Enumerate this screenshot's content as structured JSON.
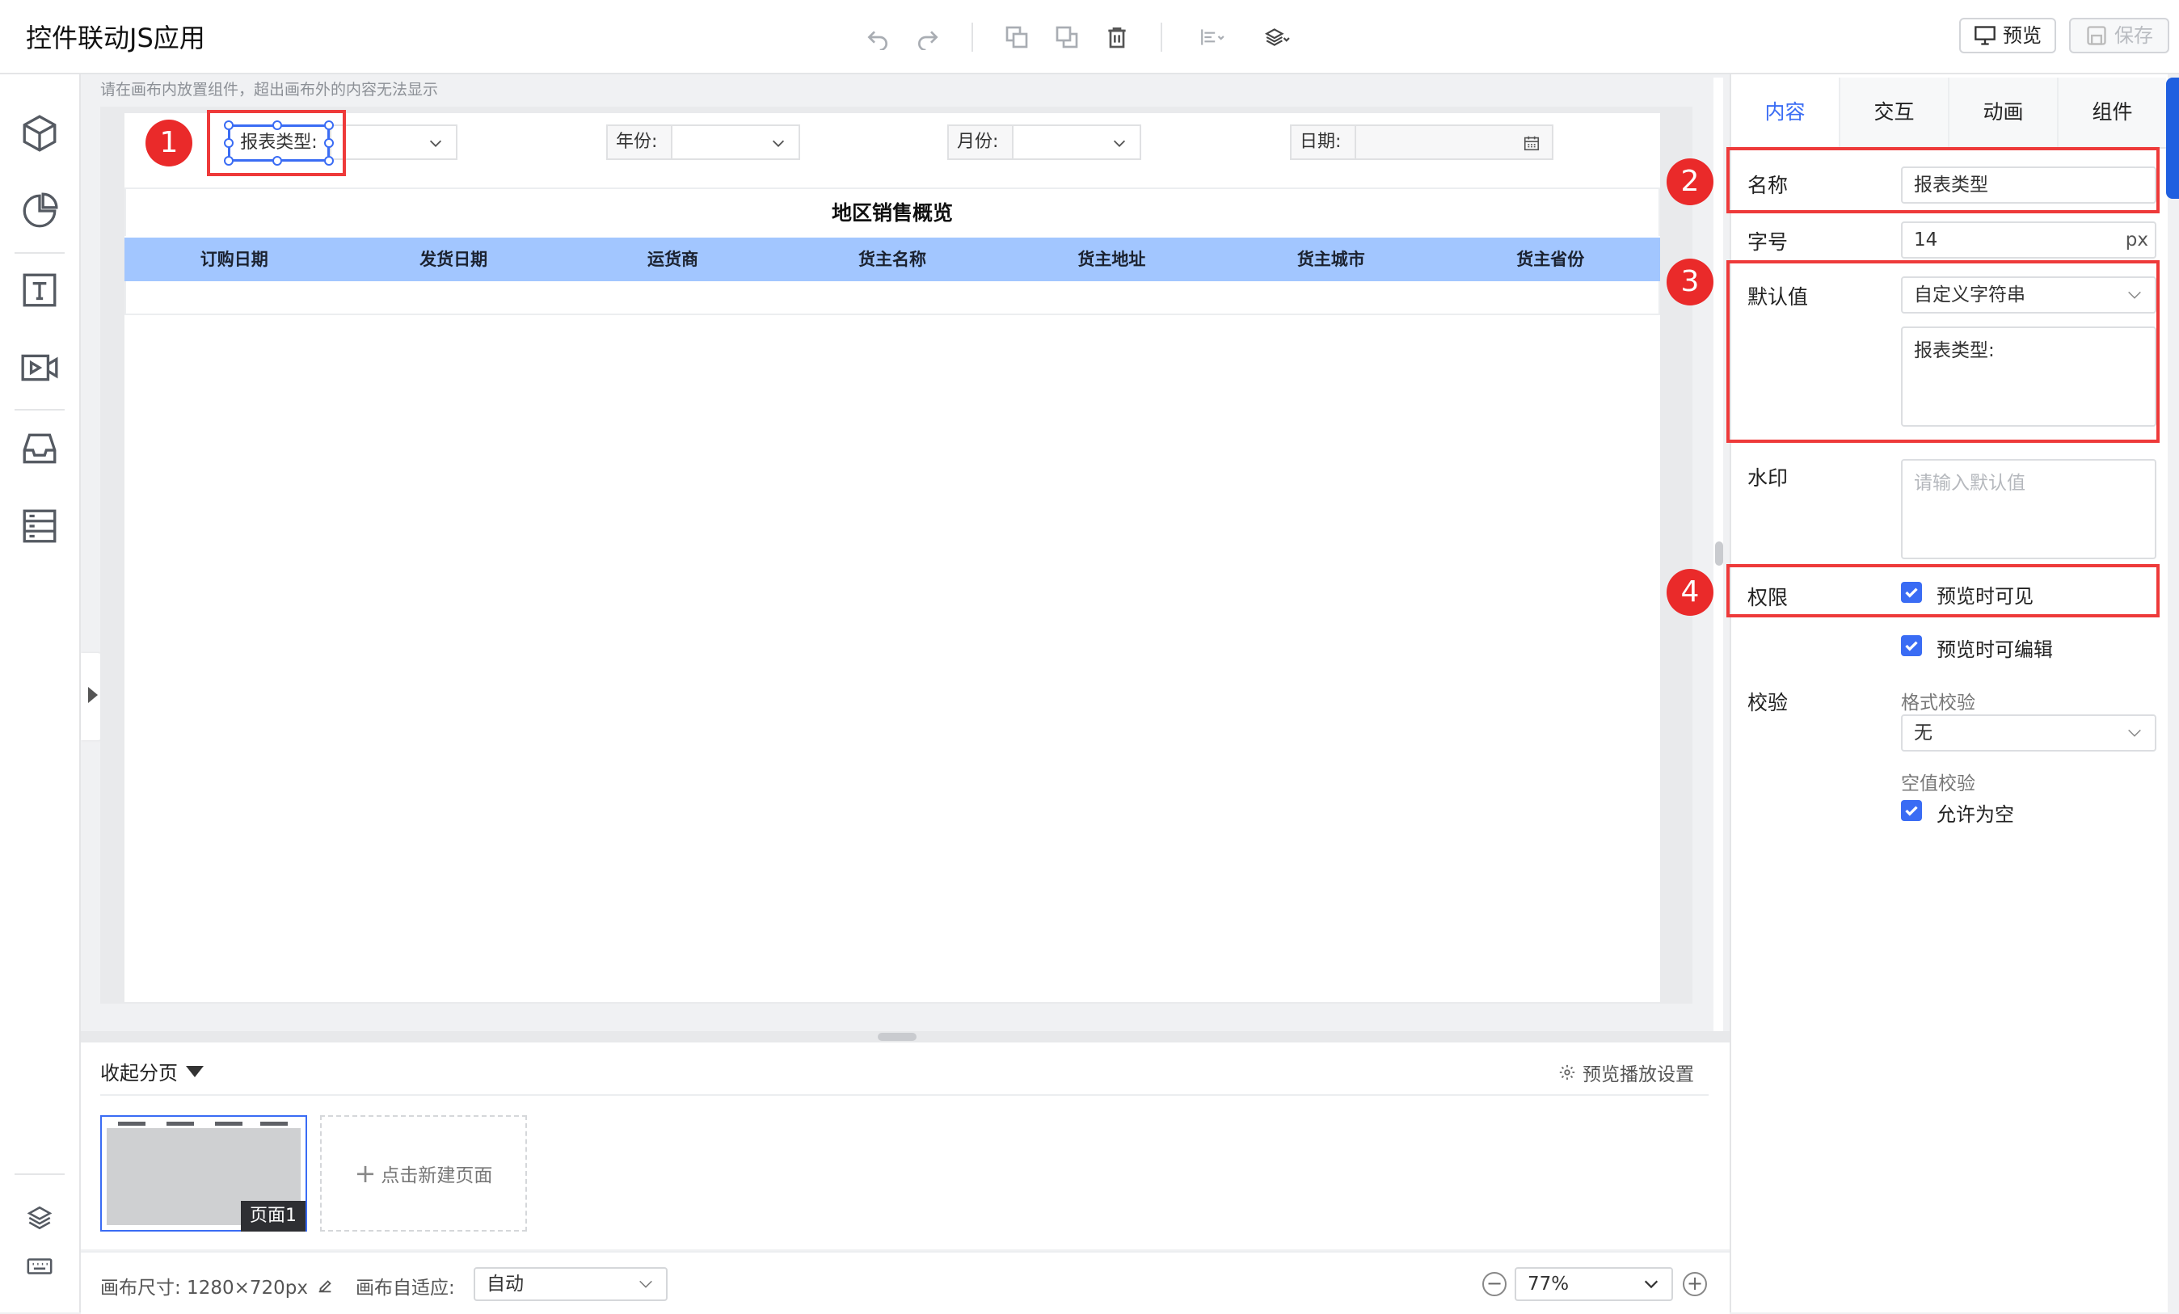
{
  "app": {
    "title": "控件联动JS应用"
  },
  "toolbar": {
    "preview_label": "预览",
    "save_label": "保存"
  },
  "canvas": {
    "hint": "请在画布内放置组件，超出画布外的内容无法显示",
    "filters": {
      "report_type_label": "报表类型:",
      "year_label": "年份:",
      "month_label": "月份:",
      "date_label": "日期:"
    },
    "table": {
      "title": "地区销售概览",
      "columns": [
        "订购日期",
        "发货日期",
        "运货商",
        "货主名称",
        "货主地址",
        "货主城市",
        "货主省份"
      ]
    }
  },
  "badges": [
    "1",
    "2",
    "3",
    "4"
  ],
  "pages": {
    "collapse_label": "收起分页",
    "preview_settings_label": "预览播放设置",
    "page1_label": "页面1",
    "new_page_label": "点击新建页面"
  },
  "status": {
    "canvas_size_label": "画布尺寸: 1280×720px",
    "adapt_label": "画布自适应:",
    "adapt_value": "自动",
    "zoom_value": "77%"
  },
  "panel": {
    "tabs": [
      "内容",
      "交互",
      "动画",
      "组件"
    ],
    "name_label": "名称",
    "name_value": "报表类型",
    "font_label": "字号",
    "font_value": "14",
    "font_unit": "px",
    "default_label": "默认值",
    "default_type": "自定义字符串",
    "default_value": "报表类型:",
    "watermark_label": "水印",
    "watermark_placeholder": "请输入默认值",
    "permission_label": "权限",
    "perm_visible": "预览时可见",
    "perm_editable": "预览时可编辑",
    "validation_label": "校验",
    "format_check_label": "格式校验",
    "format_check_value": "无",
    "empty_check_label": "空值校验",
    "allow_empty": "允许为空"
  },
  "colors": {
    "accent": "#3a6cf4",
    "highlight": "#ee3a3a",
    "table_header": "#a2c6ff"
  }
}
